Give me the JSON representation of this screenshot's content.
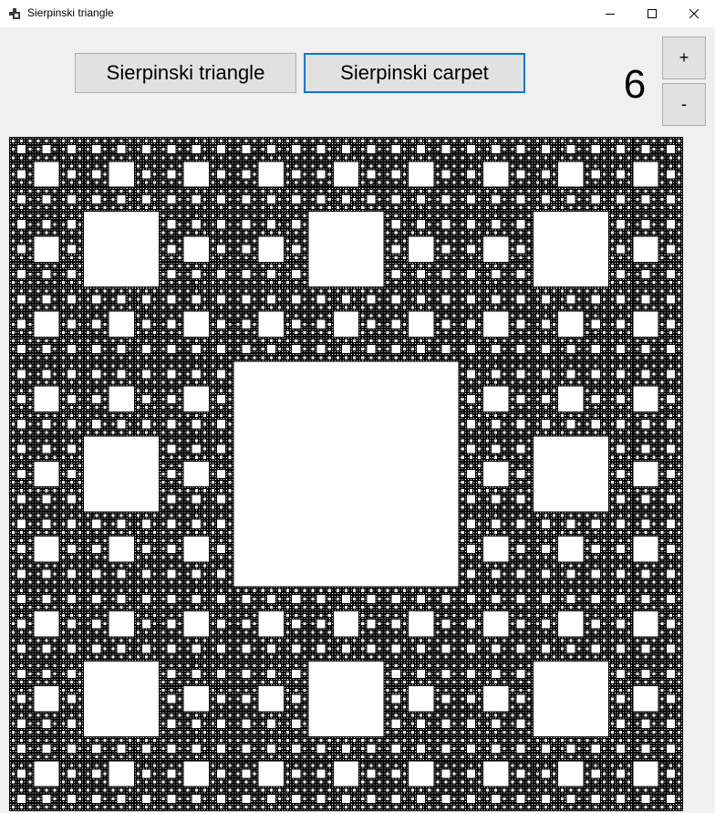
{
  "window": {
    "title": "Sierpinski triangle",
    "icon": "app-window-icon",
    "controls": [
      "minimize-icon",
      "maximize-icon",
      "close-icon"
    ]
  },
  "toolbar": {
    "triangle_label": "Sierpinski triangle",
    "carpet_label": "Sierpinski carpet",
    "plus_label": "+",
    "minus_label": "-",
    "selected": "Sierpinski carpet"
  },
  "level": {
    "value": "6"
  },
  "fractal": {
    "type": "Sierpinski carpet",
    "depth": 6,
    "fill_color": "#000000",
    "hole_color": "#ffffff"
  },
  "colors": {
    "accent": "#0078d7",
    "button_face": "#e1e1e1",
    "button_border": "#adadad",
    "window_bg": "#f0f0f0"
  }
}
